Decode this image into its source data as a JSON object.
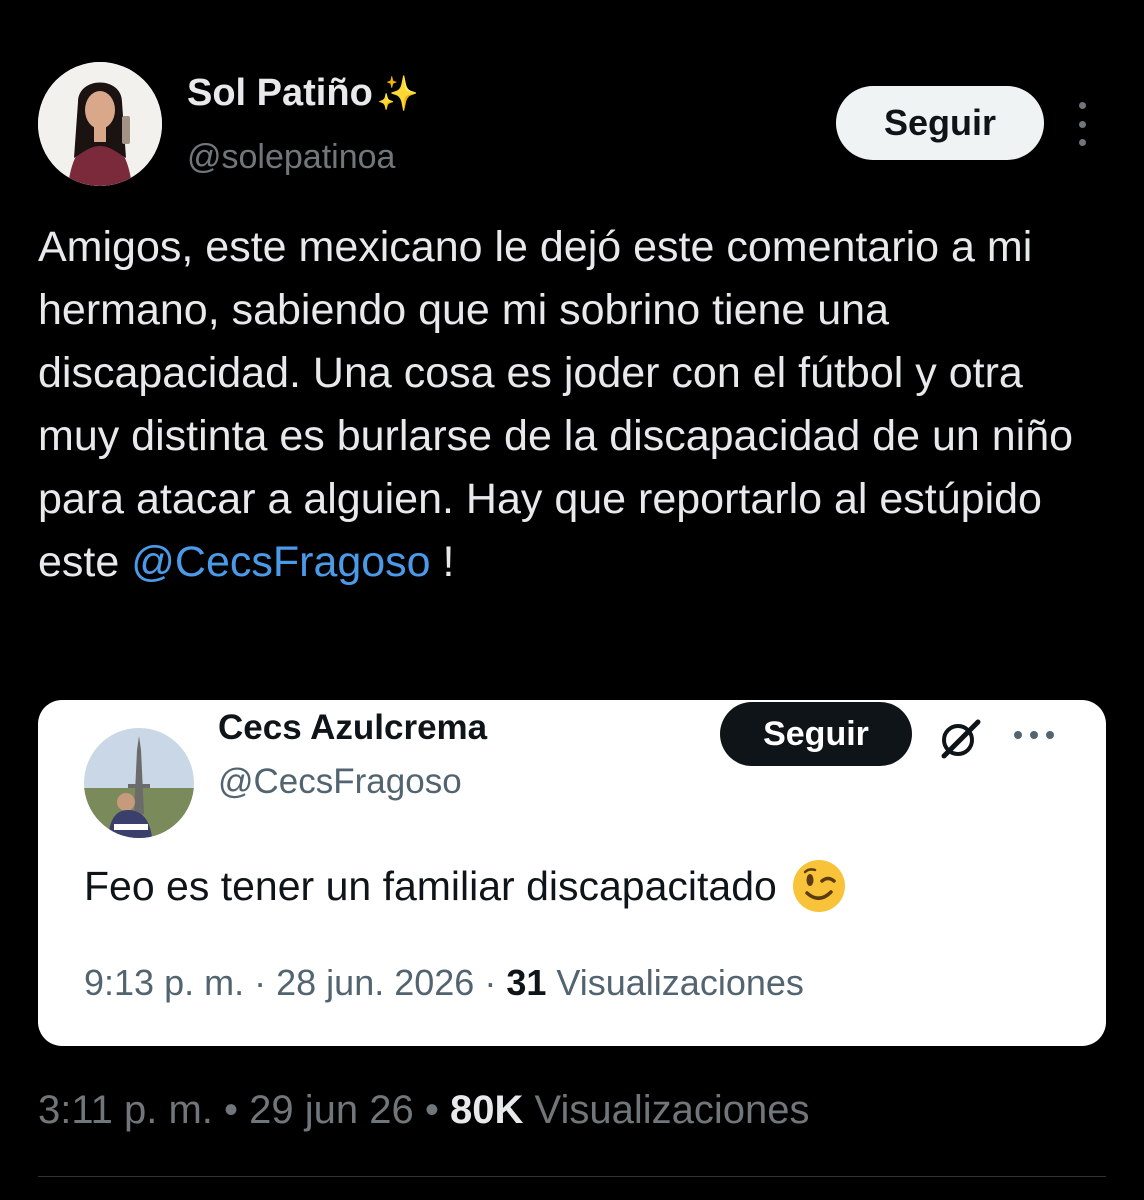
{
  "tweet": {
    "author": {
      "name": "Sol Patiño",
      "name_emoji": "✨",
      "handle": "@solepatinoa"
    },
    "follow_label": "Seguir",
    "text_main": "Amigos, este mexicano le dejó este comentario a mi hermano, sabiendo que mi sobrino tiene una discapacidad. Una cosa es joder con el fútbol y otra muy distinta es burlarse de la discapacidad de un niño para atacar a alguien. Hay que reportarlo al estúpido este",
    "mention": "@CecsFragoso",
    "text_end": " !",
    "meta": {
      "time": "3:11 p. m.",
      "date": "29 jun 26",
      "sep": "•",
      "views_count": "80K",
      "views_label": "Visualizaciones"
    }
  },
  "quoted": {
    "author": {
      "name": "Cecs Azulcrema",
      "handle": "@CecsFragoso"
    },
    "follow_label": "Seguir",
    "text": "Feo es tener un familiar discapacitado",
    "emoji": "winking-face",
    "meta": {
      "time": "9:13 p. m.",
      "date": "28 jun. 2026",
      "sep": "·",
      "views_count": "31",
      "views_label": "Visualizaciones"
    }
  },
  "colors": {
    "background": "#000000",
    "text": "#e7e9ea",
    "secondary": "#71767b",
    "mention": "#4b9ae8",
    "card": "#ffffff"
  }
}
